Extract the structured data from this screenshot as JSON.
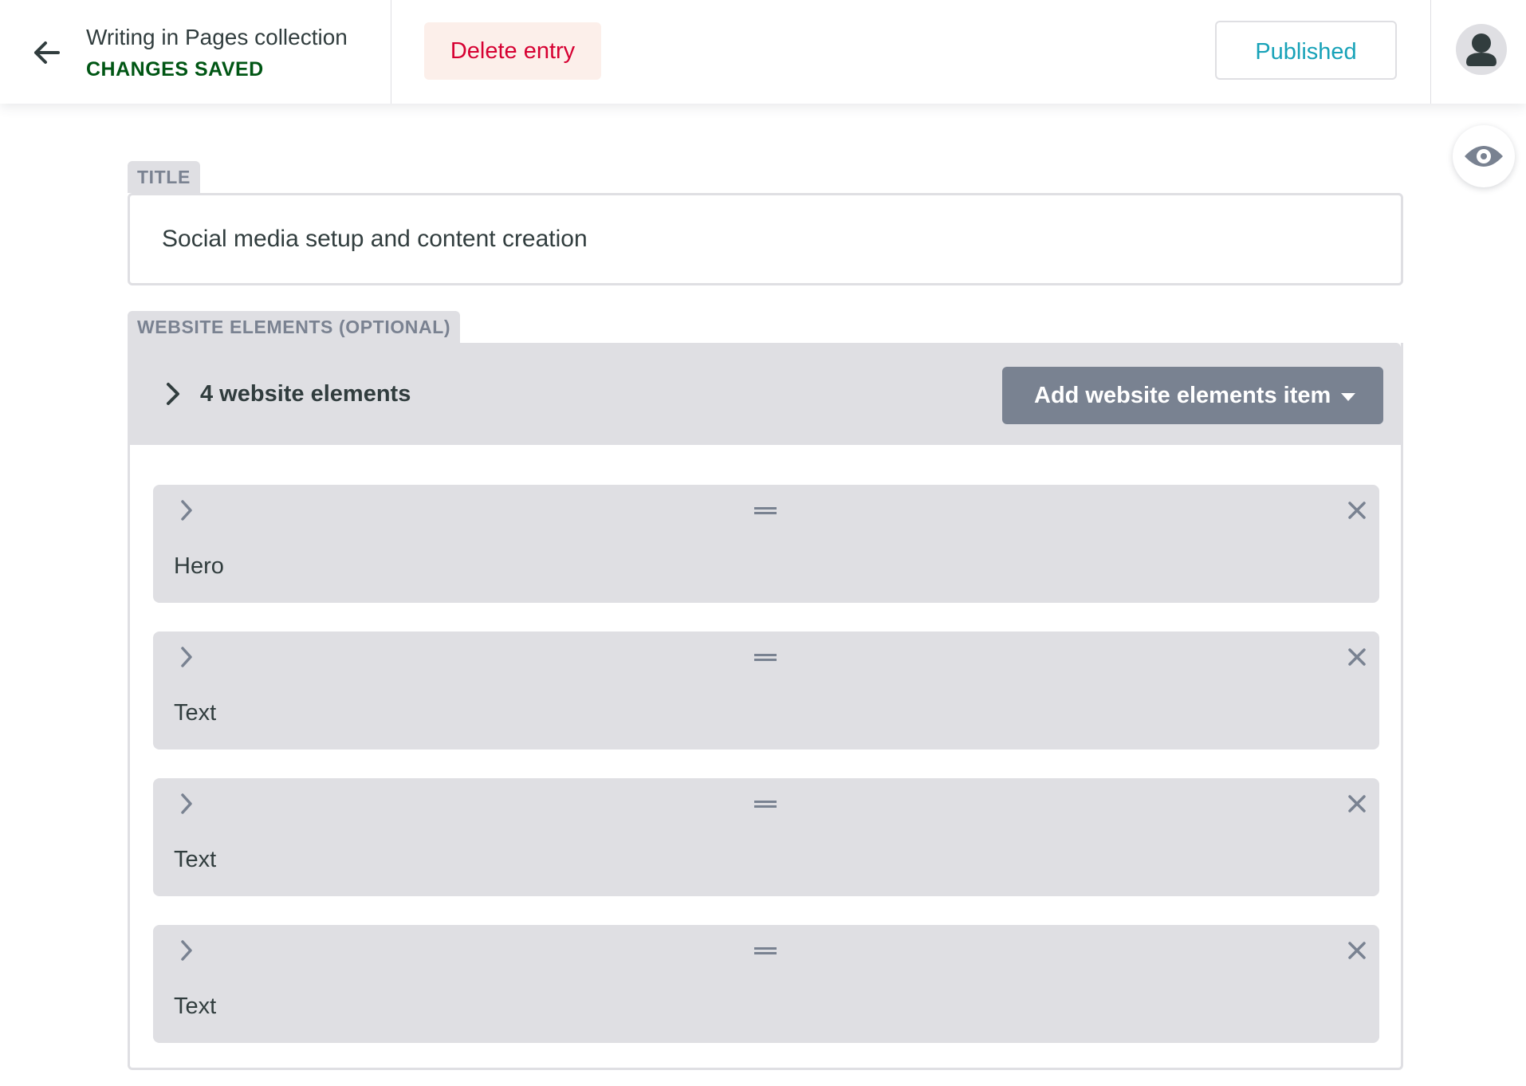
{
  "header": {
    "collection_title": "Writing in Pages collection",
    "save_status": "CHANGES SAVED",
    "delete_label": "Delete entry",
    "publish_status_label": "Published",
    "colors": {
      "saved": "#005614",
      "danger": "#d60032",
      "published": "#17a2b8"
    }
  },
  "icons": {
    "back": "arrow-left-icon",
    "avatar": "user-icon",
    "preview": "eye-icon",
    "expand": "chevron-right-icon",
    "drag": "drag-handle-icon",
    "remove": "close-icon",
    "dropdown": "caret-down-icon"
  },
  "fields": {
    "title": {
      "label": "TITLE",
      "value": "Social media setup and content creation"
    },
    "website_elements": {
      "label": "WEBSITE ELEMENTS (OPTIONAL)",
      "summary": "4 website elements",
      "add_label": "Add website elements item",
      "items": [
        {
          "label": "Hero"
        },
        {
          "label": "Text"
        },
        {
          "label": "Text"
        },
        {
          "label": "Text"
        }
      ]
    }
  }
}
